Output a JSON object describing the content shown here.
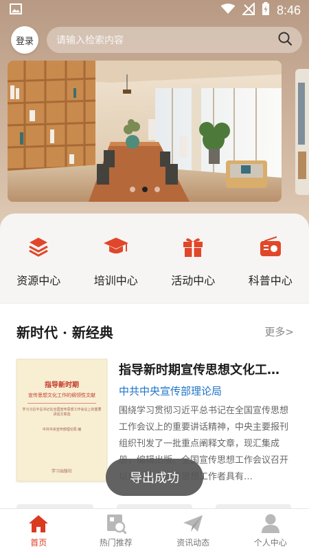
{
  "status_bar": {
    "time": "8:46"
  },
  "header": {
    "login_label": "登录",
    "search_placeholder": "请输入检索内容"
  },
  "banner": {
    "slide_count": 3,
    "active_slide": 2
  },
  "categories": [
    {
      "label": "资源中心",
      "icon": "layers-icon"
    },
    {
      "label": "培训中心",
      "icon": "graduation-cap-icon"
    },
    {
      "label": "活动中心",
      "icon": "gift-icon"
    },
    {
      "label": "科普中心",
      "icon": "radio-icon"
    }
  ],
  "section": {
    "title": "新时代 · 新经典",
    "more_label": "更多>",
    "article": {
      "title": "指导新时期宣传思想文化工作的纲领性文献",
      "source": "中共中央宣传部理论局",
      "description": "围绕学习贯彻习近平总书记在全国宣传思想工作会议上的重要讲话精神，中央主要报刊组织刊发了一批重点阐释文章，现汇集成册，编辑出版。全国宣传思想工作会议召开以来，广大宣传思想工作者具有…",
      "cover": {
        "title_line1": "指导新时期",
        "title_line2": "宣传思想文化工作的纲领性文献",
        "subtitle": "学习习近平总书记在全国宣传思想工作会议上的重要讲话文章选",
        "publisher_line": "中共中央宣传部理论局 编",
        "press": "学习出版社"
      }
    }
  },
  "toast": {
    "message": "导出成功"
  },
  "bottom_nav": [
    {
      "label": "首页",
      "icon": "home-icon",
      "active": true
    },
    {
      "label": "热门推荐",
      "icon": "recommend-icon",
      "active": false
    },
    {
      "label": "资讯动态",
      "icon": "paper-plane-icon",
      "active": false
    },
    {
      "label": "个人中心",
      "icon": "user-icon",
      "active": false
    }
  ],
  "colors": {
    "accent": "#e0472a",
    "link_blue": "#1e73c7",
    "nav_active": "#d93a20"
  }
}
